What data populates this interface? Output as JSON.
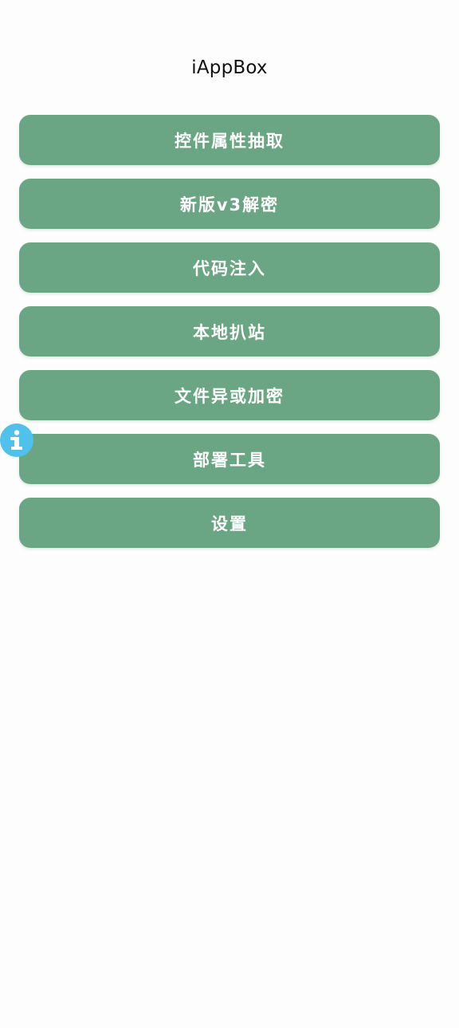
{
  "app": {
    "title": "iAppBox"
  },
  "menu": {
    "items": [
      {
        "label": "控件属性抽取"
      },
      {
        "label": "新版v3解密"
      },
      {
        "label": "代码注入"
      },
      {
        "label": "本地扒站"
      },
      {
        "label": "文件异或加密"
      },
      {
        "label": "部署工具"
      },
      {
        "label": "设置"
      }
    ]
  },
  "floating_button": {
    "icon": "info-icon"
  },
  "colors": {
    "button_bg": "#6aa683",
    "button_text": "#ffffff",
    "background": "#fdfdfd",
    "float_button": "#4fc1ea"
  }
}
